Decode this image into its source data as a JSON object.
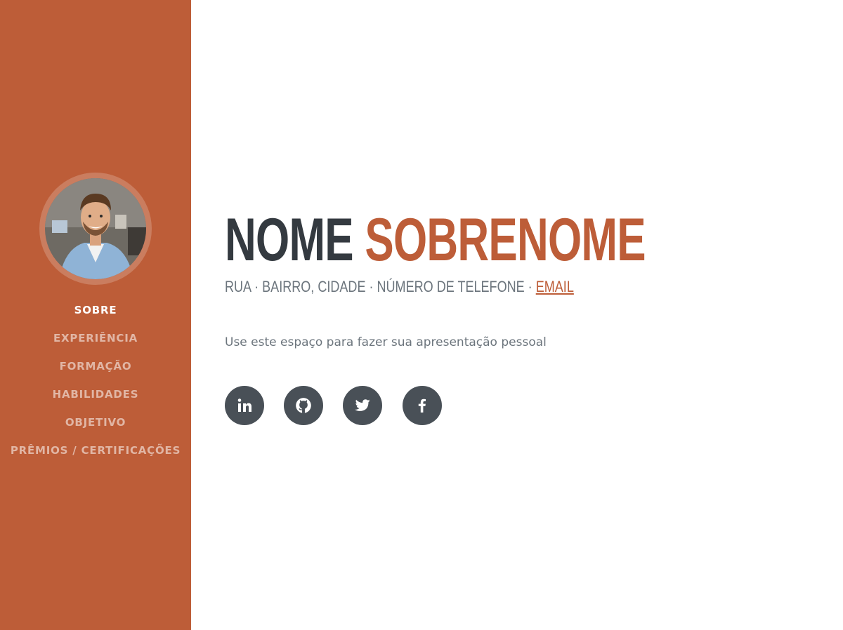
{
  "sidebar": {
    "avatar_alt": "Foto de perfil",
    "nav": [
      {
        "label": "SOBRE",
        "active": true
      },
      {
        "label": "EXPERIÊNCIA",
        "active": false
      },
      {
        "label": "FORMAÇÃO",
        "active": false
      },
      {
        "label": "HABILIDADES",
        "active": false
      },
      {
        "label": "OBJETIVO",
        "active": false
      },
      {
        "label": "PRÊMIOS / CERTIFICAÇÕES",
        "active": false
      }
    ]
  },
  "profile": {
    "first_name": "NOME",
    "last_name": "SOBRENOME",
    "address": "RUA · BAIRRO, CIDADE · NÚMERO DE TELEFONE · ",
    "email_label": "EMAIL",
    "intro": "Use este espaço para fazer sua apresentação pessoal"
  },
  "social": [
    {
      "icon": "linkedin-icon"
    },
    {
      "icon": "github-icon"
    },
    {
      "icon": "twitter-icon"
    },
    {
      "icon": "facebook-icon"
    }
  ],
  "colors": {
    "sidebar_bg": "#bd5d38",
    "accent": "#bd5d38",
    "heading": "#343a40",
    "muted": "#6c757d",
    "social_bg": "#495057"
  }
}
